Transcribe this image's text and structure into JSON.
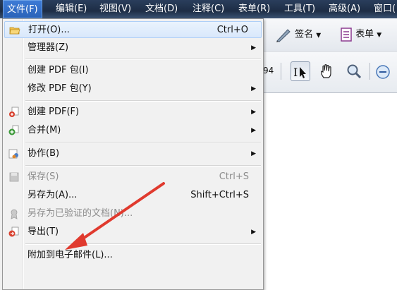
{
  "menubar": {
    "items": [
      {
        "label": "文件(F)"
      },
      {
        "label": "编辑(E)"
      },
      {
        "label": "视图(V)"
      },
      {
        "label": "文档(D)"
      },
      {
        "label": "注释(C)"
      },
      {
        "label": "表单(R)"
      },
      {
        "label": "工具(T)"
      },
      {
        "label": "高级(A)"
      },
      {
        "label": "窗口("
      }
    ]
  },
  "toolbar": {
    "sign_label": "签名",
    "form_label": "表单",
    "partial_text": "94"
  },
  "file_menu": {
    "items": [
      {
        "label": "打开(O)...",
        "shortcut": "Ctrl+O"
      },
      {
        "label": "管理器(Z)"
      },
      {
        "label": "创建 PDF 包(I)"
      },
      {
        "label": "修改 PDF 包(Y)"
      },
      {
        "label": "创建 PDF(F)"
      },
      {
        "label": "合并(M)"
      },
      {
        "label": "协作(B)"
      },
      {
        "label": "保存(S)",
        "shortcut": "Ctrl+S"
      },
      {
        "label": "另存为(A)...",
        "shortcut": "Shift+Ctrl+S"
      },
      {
        "label": "另存为已验证的文档(N)..."
      },
      {
        "label": "导出(T)"
      },
      {
        "label": "附加到电子邮件(L)..."
      }
    ]
  },
  "colors": {
    "annotation_arrow": "#e03a2e",
    "menubar_active": "#3d7bd6"
  }
}
